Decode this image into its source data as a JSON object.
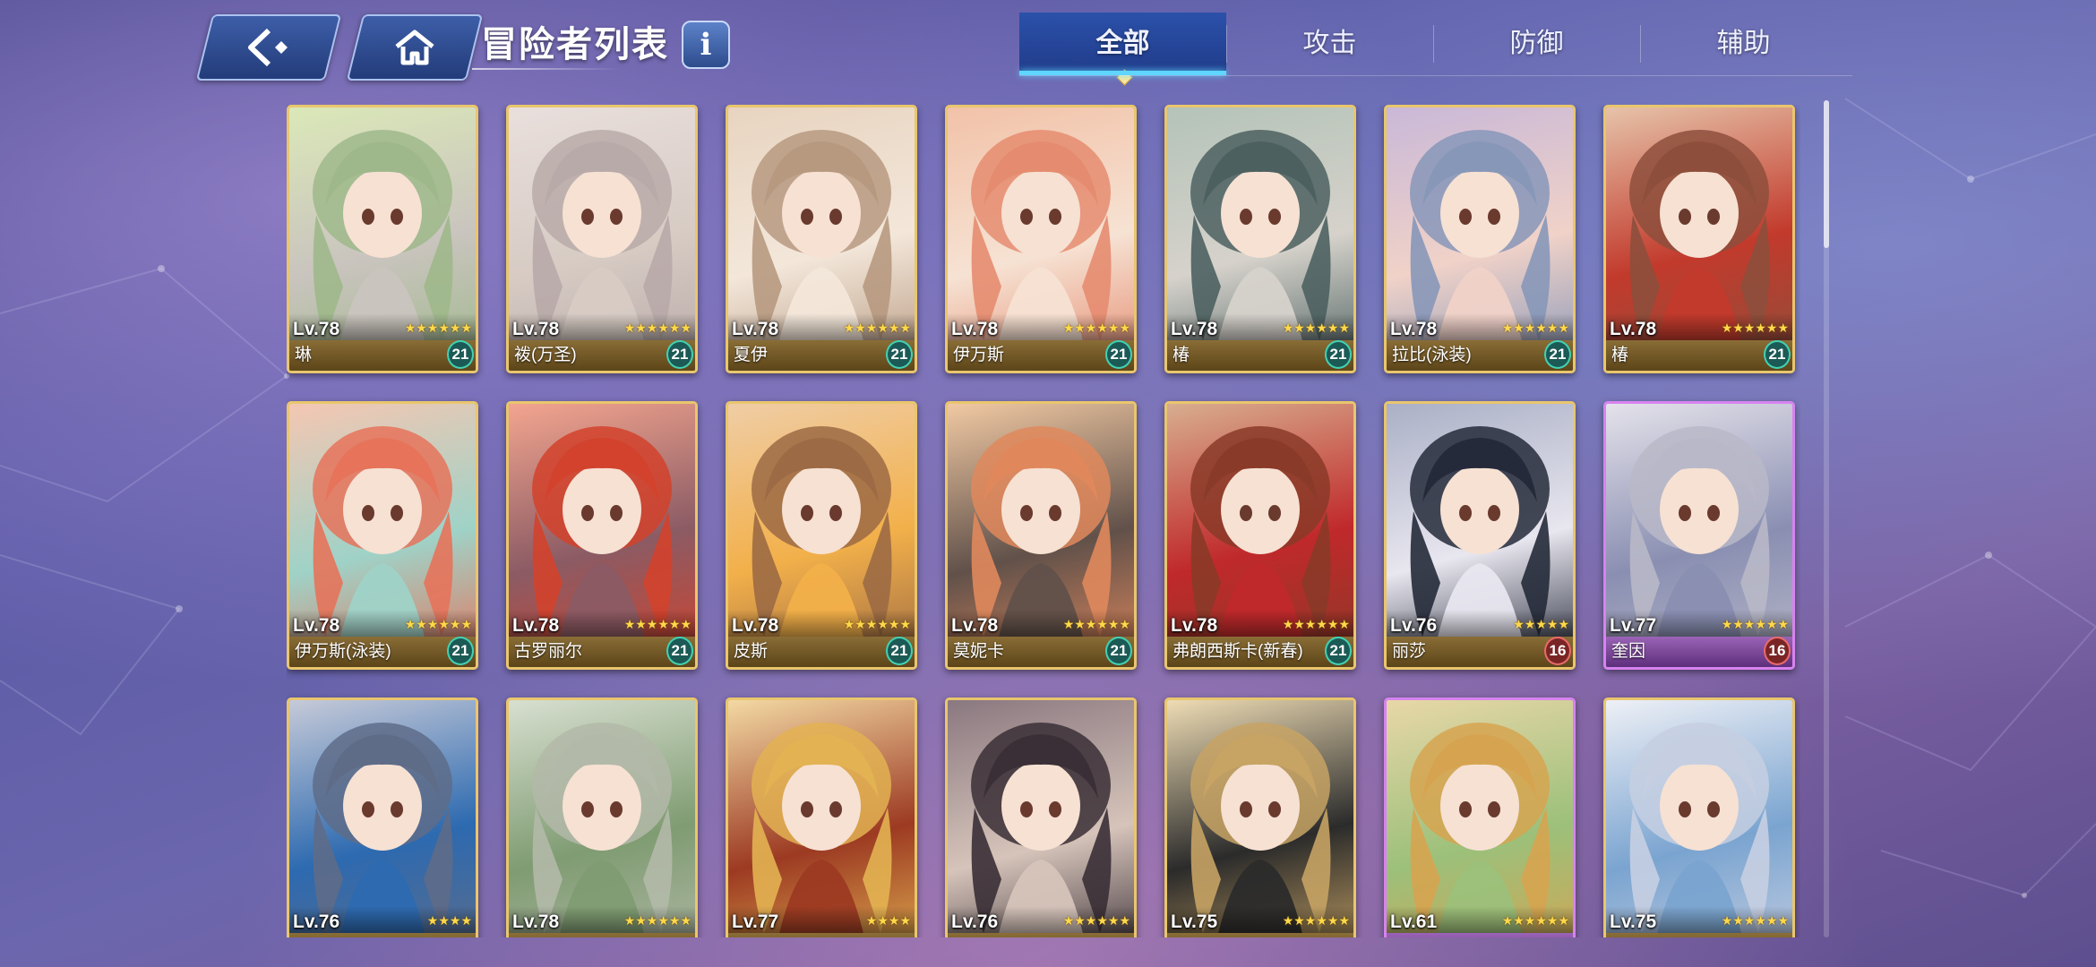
{
  "header": {
    "back_icon": "back-icon",
    "home_icon": "home-icon",
    "title": "冒险者列表",
    "info_label": "i"
  },
  "tabs": [
    {
      "label": "全部",
      "active": true
    },
    {
      "label": "攻击",
      "active": false
    },
    {
      "label": "防御",
      "active": false
    },
    {
      "label": "辅助",
      "active": false
    }
  ],
  "adventurers": [
    {
      "level": "Lv.78",
      "stars": 6,
      "name": "琳",
      "badge": "21",
      "palette": [
        "#dbe8b8",
        "#9fb88b",
        "#c9c4be"
      ]
    },
    {
      "level": "Lv.78",
      "stars": 6,
      "name": "袯(万圣)",
      "badge": "21",
      "palette": [
        "#e9dfdc",
        "#b8aaa8",
        "#d7cbc4"
      ]
    },
    {
      "level": "Lv.78",
      "stars": 6,
      "name": "夏伊",
      "badge": "21",
      "palette": [
        "#e8d4c0",
        "#b79980",
        "#f3e7da"
      ]
    },
    {
      "level": "Lv.78",
      "stars": 6,
      "name": "伊万斯",
      "badge": "21",
      "palette": [
        "#f2c2a8",
        "#e58c70",
        "#f6e2d3"
      ]
    },
    {
      "level": "Lv.78",
      "stars": 6,
      "name": "椿",
      "badge": "21",
      "palette": [
        "#b4c3b8",
        "#4c6060",
        "#d6d2cb"
      ]
    },
    {
      "level": "Lv.78",
      "stars": 6,
      "name": "拉比(泳装)",
      "badge": "21",
      "palette": [
        "#c9b8d8",
        "#8797b8",
        "#f0d2c8"
      ]
    },
    {
      "level": "Lv.78",
      "stars": 6,
      "name": "椿",
      "badge": "21",
      "palette": [
        "#e6c3a9",
        "#8d4f3c",
        "#c23a2c"
      ]
    },
    {
      "level": "Lv.78",
      "stars": 6,
      "name": "伊万斯(泳装)",
      "badge": "21",
      "palette": [
        "#f4c7b2",
        "#e6735a",
        "#9fd2c7"
      ]
    },
    {
      "level": "Lv.78",
      "stars": 6,
      "name": "古罗丽尔",
      "badge": "21",
      "palette": [
        "#f3a58f",
        "#d2422c",
        "#8b5b64"
      ]
    },
    {
      "level": "Lv.78",
      "stars": 6,
      "name": "皮斯",
      "badge": "21",
      "palette": [
        "#f0cda5",
        "#9c6a44",
        "#f2b04a"
      ]
    },
    {
      "level": "Lv.78",
      "stars": 6,
      "name": "莫妮卡",
      "badge": "21",
      "palette": [
        "#f1c9a3",
        "#e0885c",
        "#61514a"
      ]
    },
    {
      "level": "Lv.78",
      "stars": 6,
      "name": "弗朗西斯卡(新春)",
      "badge": "21",
      "palette": [
        "#d8ae8f",
        "#8a3a28",
        "#c0292b"
      ]
    },
    {
      "level": "Lv.76",
      "stars": 5,
      "name": "丽莎",
      "badge": "16",
      "badge_red": true,
      "palette": [
        "#aab0c6",
        "#252a3a",
        "#e8e6ef"
      ]
    },
    {
      "level": "Lv.77",
      "stars": 6,
      "name": "奎因",
      "badge": "16",
      "badge_red": true,
      "purple": true,
      "palette": [
        "#e4e2ea",
        "#b8b8c8",
        "#8a8fb2"
      ]
    },
    {
      "level": "Lv.76",
      "stars": 4,
      "name": "",
      "palette": [
        "#c6cad8",
        "#5e6c88",
        "#2d6ab0"
      ]
    },
    {
      "level": "Lv.78",
      "stars": 6,
      "name": "",
      "palette": [
        "#d8dfd0",
        "#b3b9a8",
        "#7f9c72"
      ]
    },
    {
      "level": "Lv.77",
      "stars": 4,
      "name": "",
      "palette": [
        "#f3d9a4",
        "#e3b252",
        "#9c3a22"
      ]
    },
    {
      "level": "Lv.76",
      "stars": 6,
      "name": "",
      "palette": [
        "#8a7880",
        "#3a2f36",
        "#d6c4ba"
      ]
    },
    {
      "level": "Lv.75",
      "stars": 6,
      "name": "",
      "palette": [
        "#eedcb4",
        "#c7a364",
        "#2b2b2b"
      ]
    },
    {
      "level": "Lv.61",
      "stars": 6,
      "name": "",
      "purple": true,
      "palette": [
        "#e8d7a8",
        "#d6a450",
        "#9cc07a"
      ]
    },
    {
      "level": "Lv.75",
      "stars": 6,
      "name": "",
      "palette": [
        "#eef0f6",
        "#c6cfe2",
        "#7aa4d0"
      ]
    }
  ]
}
